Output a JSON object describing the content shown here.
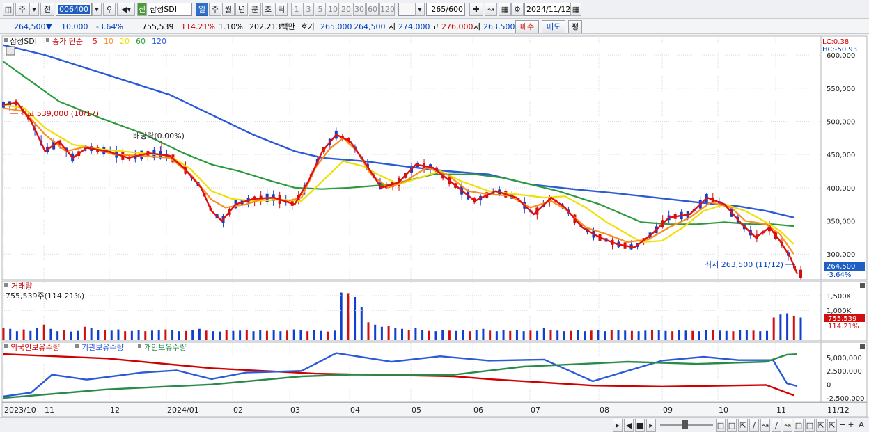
{
  "toolbar": {
    "type_label": "주",
    "prefix_label": "전",
    "code_value": "006400",
    "new_badge": "신",
    "stock_name": "삼성SDI",
    "periods": [
      "일",
      "주",
      "월",
      "년",
      "분",
      "초",
      "틱"
    ],
    "active_period": "일",
    "intervals": [
      "1",
      "3",
      "5",
      "10",
      "20",
      "30",
      "60",
      "120"
    ],
    "count_value": "265",
    "count_total": "/600",
    "date_value": "2024/11/12"
  },
  "infobar": {
    "price": "264,500",
    "change": "10,000",
    "change_pct": "-3.64%",
    "volume": "755,539",
    "volume_ratio": "114.21%",
    "turnover": "1.10%",
    "amount": "202,213백만",
    "quote_label": "호가",
    "ask": "265,000",
    "bid": "264,500",
    "open_label": "시",
    "open": "274,000",
    "high_label": "고",
    "high": "276,000",
    "low_label": "저",
    "low": "263,500",
    "buy_button": "매수",
    "sell_button": "매도",
    "eval_button": "평"
  },
  "price_panel": {
    "name": "삼성SDI",
    "legend_title": "종가 단순",
    "ma_legend": [
      {
        "period": "5",
        "color": "#e01010"
      },
      {
        "period": "10",
        "color": "#ff8c1a"
      },
      {
        "period": "20",
        "color": "#f0e000"
      },
      {
        "period": "60",
        "color": "#2a9a3a"
      },
      {
        "period": "120",
        "color": "#2a5ad8"
      }
    ],
    "lc_label": "LC:0.38",
    "hc_label": "HC:-50.93",
    "high_annotation": "최고 539,000 (10/17)",
    "dividend_annotation": "배당락(0.00%)",
    "low_annotation": "최저 263,500 (11/12)",
    "price_tag": "264,500",
    "change_tag": "-3.64%",
    "y_ticks": [
      "600,000",
      "550,000",
      "500,000",
      "450,000",
      "400,000",
      "350,000",
      "300,000"
    ]
  },
  "volume_panel": {
    "title": "거래량",
    "value_label": "755,539주(114.21%)",
    "y_ticks": [
      "1,500K",
      "1,000K"
    ],
    "volume_tag": "755,539",
    "ratio_tag": "114.21%"
  },
  "holding_panel": {
    "series_labels": [
      {
        "label": "외국인보유수량",
        "color": "#d00000"
      },
      {
        "label": "기관보유수량",
        "color": "#2a5ad8"
      },
      {
        "label": "개인보유수량",
        "color": "#2a8a4a"
      }
    ],
    "y_ticks": [
      "5,000,000",
      "2,500,000",
      "0",
      "-2,500,000"
    ]
  },
  "x_axis": {
    "labels": [
      "2023/10",
      "11",
      "12",
      "2024/01",
      "02",
      "03",
      "04",
      "05",
      "06",
      "07",
      "08",
      "09",
      "10",
      "11"
    ],
    "end_label": "11/12"
  },
  "colors": {
    "up": "#d01010",
    "down": "#1040d0",
    "ma5": "#e01010",
    "ma10": "#ff8c1a",
    "ma20": "#f0e000",
    "ma60": "#2a9a3a",
    "ma120": "#2a5ad8"
  },
  "chart_data": {
    "type": "line",
    "title": "삼성SDI",
    "y_unit": "KRW",
    "ylim": [
      263500,
      620000
    ],
    "ma_series": [
      {
        "name": "120",
        "points": [
          [
            0,
            615000
          ],
          [
            60,
            600000
          ],
          [
            120,
            580000
          ],
          [
            180,
            560000
          ],
          [
            240,
            540000
          ],
          [
            300,
            510000
          ],
          [
            360,
            480000
          ],
          [
            420,
            455000
          ],
          [
            460,
            445000
          ],
          [
            520,
            440000
          ],
          [
            580,
            432000
          ],
          [
            640,
            425000
          ],
          [
            700,
            420000
          ],
          [
            760,
            405000
          ],
          [
            820,
            398000
          ],
          [
            880,
            392000
          ],
          [
            940,
            385000
          ],
          [
            1000,
            378000
          ],
          [
            1060,
            372000
          ],
          [
            1100,
            365000
          ],
          [
            1140,
            355000
          ]
        ]
      },
      {
        "name": "60",
        "points": [
          [
            0,
            590000
          ],
          [
            40,
            560000
          ],
          [
            80,
            530000
          ],
          [
            140,
            505000
          ],
          [
            200,
            482000
          ],
          [
            260,
            452000
          ],
          [
            300,
            435000
          ],
          [
            340,
            425000
          ],
          [
            380,
            412000
          ],
          [
            420,
            400000
          ],
          [
            460,
            398000
          ],
          [
            500,
            400000
          ],
          [
            560,
            405000
          ],
          [
            620,
            420000
          ],
          [
            680,
            420000
          ],
          [
            720,
            415000
          ],
          [
            760,
            405000
          ],
          [
            800,
            395000
          ],
          [
            860,
            375000
          ],
          [
            920,
            348000
          ],
          [
            960,
            345000
          ],
          [
            1000,
            345000
          ],
          [
            1040,
            348000
          ],
          [
            1080,
            345000
          ],
          [
            1110,
            345000
          ],
          [
            1140,
            342000
          ]
        ]
      },
      {
        "name": "20",
        "points": [
          [
            0,
            525000
          ],
          [
            30,
            520000
          ],
          [
            60,
            490000
          ],
          [
            100,
            465000
          ],
          [
            140,
            458000
          ],
          [
            200,
            452000
          ],
          [
            240,
            448000
          ],
          [
            270,
            428000
          ],
          [
            300,
            395000
          ],
          [
            330,
            383000
          ],
          [
            360,
            380000
          ],
          [
            400,
            382000
          ],
          [
            430,
            380000
          ],
          [
            460,
            410000
          ],
          [
            490,
            440000
          ],
          [
            520,
            432000
          ],
          [
            540,
            420000
          ],
          [
            570,
            405000
          ],
          [
            600,
            415000
          ],
          [
            630,
            425000
          ],
          [
            660,
            410000
          ],
          [
            700,
            395000
          ],
          [
            740,
            390000
          ],
          [
            780,
            385000
          ],
          [
            810,
            387000
          ],
          [
            840,
            370000
          ],
          [
            870,
            348000
          ],
          [
            900,
            330000
          ],
          [
            920,
            318000
          ],
          [
            950,
            320000
          ],
          [
            980,
            340000
          ],
          [
            1010,
            365000
          ],
          [
            1040,
            375000
          ],
          [
            1070,
            365000
          ],
          [
            1100,
            348000
          ],
          [
            1120,
            335000
          ],
          [
            1140,
            315000
          ]
        ]
      },
      {
        "name": "10",
        "points": [
          [
            0,
            520000
          ],
          [
            30,
            515000
          ],
          [
            60,
            480000
          ],
          [
            90,
            455000
          ],
          [
            120,
            462000
          ],
          [
            160,
            450000
          ],
          [
            200,
            448000
          ],
          [
            240,
            445000
          ],
          [
            270,
            420000
          ],
          [
            300,
            382000
          ],
          [
            320,
            370000
          ],
          [
            350,
            375000
          ],
          [
            380,
            385000
          ],
          [
            410,
            380000
          ],
          [
            430,
            385000
          ],
          [
            450,
            430000
          ],
          [
            470,
            458000
          ],
          [
            490,
            475000
          ],
          [
            510,
            455000
          ],
          [
            530,
            420000
          ],
          [
            555,
            400000
          ],
          [
            580,
            410000
          ],
          [
            610,
            430000
          ],
          [
            640,
            420000
          ],
          [
            670,
            395000
          ],
          [
            700,
            390000
          ],
          [
            730,
            388000
          ],
          [
            760,
            370000
          ],
          [
            790,
            380000
          ],
          [
            810,
            368000
          ],
          [
            840,
            340000
          ],
          [
            870,
            330000
          ],
          [
            900,
            318000
          ],
          [
            930,
            322000
          ],
          [
            960,
            340000
          ],
          [
            990,
            355000
          ],
          [
            1020,
            378000
          ],
          [
            1050,
            370000
          ],
          [
            1070,
            350000
          ],
          [
            1100,
            345000
          ],
          [
            1120,
            330000
          ],
          [
            1140,
            300000
          ]
        ]
      },
      {
        "name": "5",
        "points": [
          [
            0,
            525000
          ],
          [
            20,
            528000
          ],
          [
            40,
            500000
          ],
          [
            60,
            455000
          ],
          [
            80,
            470000
          ],
          [
            100,
            445000
          ],
          [
            120,
            460000
          ],
          [
            150,
            455000
          ],
          [
            180,
            445000
          ],
          [
            210,
            452000
          ],
          [
            240,
            448000
          ],
          [
            260,
            430000
          ],
          [
            285,
            400000
          ],
          [
            300,
            365000
          ],
          [
            315,
            350000
          ],
          [
            335,
            375000
          ],
          [
            360,
            383000
          ],
          [
            390,
            385000
          ],
          [
            420,
            375000
          ],
          [
            440,
            410000
          ],
          [
            460,
            455000
          ],
          [
            480,
            480000
          ],
          [
            500,
            470000
          ],
          [
            520,
            440000
          ],
          [
            545,
            400000
          ],
          [
            570,
            408000
          ],
          [
            595,
            435000
          ],
          [
            620,
            430000
          ],
          [
            650,
            405000
          ],
          [
            680,
            380000
          ],
          [
            710,
            395000
          ],
          [
            740,
            385000
          ],
          [
            765,
            360000
          ],
          [
            790,
            385000
          ],
          [
            810,
            370000
          ],
          [
            835,
            340000
          ],
          [
            860,
            325000
          ],
          [
            885,
            315000
          ],
          [
            910,
            310000
          ],
          [
            935,
            330000
          ],
          [
            960,
            355000
          ],
          [
            990,
            360000
          ],
          [
            1015,
            385000
          ],
          [
            1040,
            375000
          ],
          [
            1065,
            345000
          ],
          [
            1085,
            325000
          ],
          [
            1105,
            340000
          ],
          [
            1120,
            320000
          ],
          [
            1135,
            295000
          ],
          [
            1145,
            270000
          ]
        ]
      }
    ],
    "volume_bars_K": [
      420,
      380,
      300,
      360,
      310,
      420,
      520,
      380,
      300,
      330,
      290,
      310,
      450,
      400,
      350,
      330,
      320,
      360,
      300,
      310,
      330,
      300,
      320,
      340,
      360,
      330,
      300,
      310,
      350,
      380,
      320,
      300,
      290,
      340,
      310,
      320,
      330,
      300,
      350,
      310,
      330,
      300,
      320,
      360,
      340,
      300,
      330,
      310,
      290,
      320,
      1600,
      1580,
      1450,
      1100,
      600,
      520,
      450,
      480,
      420,
      380,
      350,
      400,
      330,
      310,
      300,
      340,
      320,
      310,
      330,
      300,
      350,
      380,
      320,
      300,
      340,
      310,
      330,
      300,
      320,
      310,
      400,
      350,
      320,
      300,
      310,
      330,
      300,
      320,
      340,
      300,
      330,
      350,
      320,
      310,
      300,
      320,
      330,
      340,
      310,
      300,
      330,
      320,
      310,
      300,
      350,
      330,
      320,
      310,
      300,
      340,
      330,
      320,
      300,
      310,
      760,
      860,
      900,
      820,
      760
    ]
  }
}
